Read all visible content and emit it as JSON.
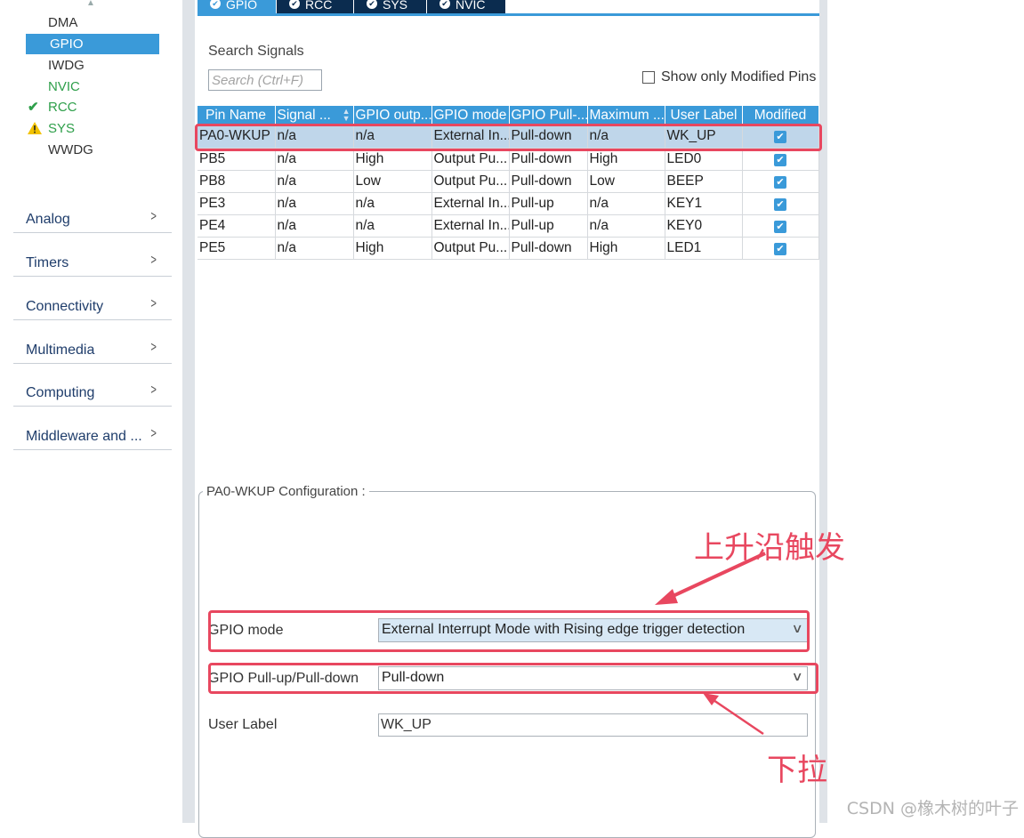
{
  "sidebar": {
    "system_items": [
      {
        "label": "DMA",
        "status": ""
      },
      {
        "label": "GPIO",
        "status": "selected"
      },
      {
        "label": "IWDG",
        "status": ""
      },
      {
        "label": "NVIC",
        "status": "ok"
      },
      {
        "label": "RCC",
        "status": "ok"
      },
      {
        "label": "SYS",
        "status": "warning"
      },
      {
        "label": "WWDG",
        "status": ""
      }
    ],
    "categories": [
      "Analog",
      "Timers",
      "Connectivity",
      "Multimedia",
      "Computing",
      "Middleware and ..."
    ]
  },
  "tabs": [
    {
      "label": "GPIO",
      "active": true
    },
    {
      "label": "RCC",
      "active": false
    },
    {
      "label": "SYS",
      "active": false
    },
    {
      "label": "NVIC",
      "active": false
    }
  ],
  "search": {
    "label": "Search Signals",
    "placeholder": "Search (Ctrl+F)",
    "value": ""
  },
  "show_modified": {
    "label": "Show only Modified Pins",
    "checked": false
  },
  "table": {
    "headers": [
      "Pin Name",
      "Signal ...",
      "GPIO outp...",
      "GPIO mode",
      "GPIO Pull-...",
      "Maximum ...",
      "User Label",
      "Modified"
    ],
    "rows": [
      {
        "cells": [
          "PA0-WKUP",
          "n/a",
          "n/a",
          "External In...",
          "Pull-down",
          "n/a",
          "WK_UP"
        ],
        "modified": true,
        "selected": true
      },
      {
        "cells": [
          "PB5",
          "n/a",
          "High",
          "Output Pu...",
          "Pull-down",
          "High",
          "LED0"
        ],
        "modified": true,
        "selected": false
      },
      {
        "cells": [
          "PB8",
          "n/a",
          "Low",
          "Output Pu...",
          "Pull-down",
          "Low",
          "BEEP"
        ],
        "modified": true,
        "selected": false
      },
      {
        "cells": [
          "PE3",
          "n/a",
          "n/a",
          "External In...",
          "Pull-up",
          "n/a",
          "KEY1"
        ],
        "modified": true,
        "selected": false
      },
      {
        "cells": [
          "PE4",
          "n/a",
          "n/a",
          "External In...",
          "Pull-up",
          "n/a",
          "KEY0"
        ],
        "modified": true,
        "selected": false
      },
      {
        "cells": [
          "PE5",
          "n/a",
          "High",
          "Output Pu...",
          "Pull-down",
          "High",
          "LED1"
        ],
        "modified": true,
        "selected": false
      }
    ]
  },
  "config": {
    "title": "PA0-WKUP Configuration :",
    "gpio_mode_label": "GPIO mode",
    "gpio_mode_value": "External Interrupt Mode with Rising edge trigger detection",
    "pull_label": "GPIO Pull-up/Pull-down",
    "pull_value": "Pull-down",
    "user_label_label": "User Label",
    "user_label_value": "WK_UP"
  },
  "annotations": {
    "rising_edge": "上升沿触发",
    "pull_down": "下拉",
    "color": "#e8475f"
  },
  "watermark": "CSDN @橡木树的叶子",
  "colors": {
    "accent": "#3a9ad9",
    "tab_dark": "#0b2c4f",
    "ok_green": "#2e9f4a",
    "warning": "#f2c200"
  }
}
